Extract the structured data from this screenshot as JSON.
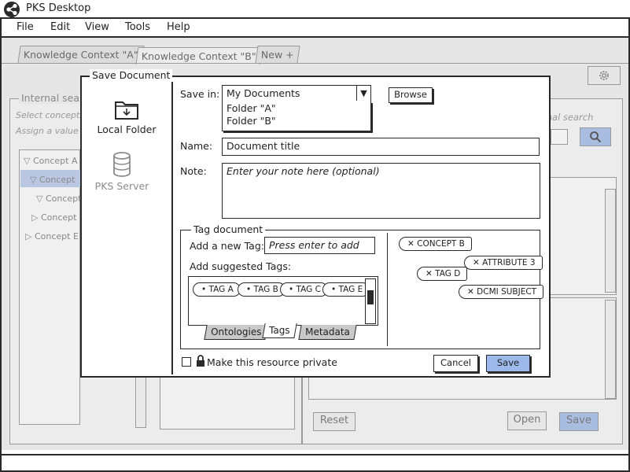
{
  "app": {
    "title": "PKS Desktop"
  },
  "menu": [
    "File",
    "Edit",
    "View",
    "Tools",
    "Help"
  ],
  "tabs": [
    {
      "label": "Knowledge Context \"A\""
    },
    {
      "label": "Knowledge Context \"B\""
    },
    {
      "label": "New +"
    }
  ],
  "background": {
    "left_panel": {
      "title": "Internal sear",
      "hint1": "Select concepts",
      "hint2": "Assign a value t",
      "tree": [
        "Concept A",
        "Concept",
        "Concept",
        "Concept I",
        "Concept E"
      ]
    },
    "right_panel": {
      "search_hint": "rnal search"
    },
    "buttons": {
      "reset": "Reset",
      "open": "Open",
      "save": "Save"
    }
  },
  "dialog": {
    "title": "Save Document",
    "locations": [
      {
        "label": "Local Folder",
        "icon": "folder-icon",
        "enabled": true
      },
      {
        "label": "PKS Server",
        "icon": "database-icon",
        "enabled": false
      }
    ],
    "save_in": {
      "label": "Save in:",
      "value": "My Documents",
      "options": [
        "Folder \"A\"",
        "Folder \"B\""
      ],
      "browse_label": "Browse"
    },
    "name": {
      "label": "Name:",
      "value": "Document title"
    },
    "note": {
      "label": "Note:",
      "placeholder": "Enter your note here (optional)"
    },
    "tag_document": {
      "title": "Tag document",
      "add_new_label": "Add a new Tag:",
      "add_new_placeholder": "Press enter to add",
      "suggested_label": "Add suggested Tags:",
      "suggested_tags": [
        "TAG A",
        "TAG B",
        "TAG C",
        "TAG E"
      ],
      "subtabs": [
        "Ontologies",
        "Tags",
        "Metadata"
      ],
      "active_subtab": "Tags",
      "applied_tags": [
        "CONCEPT B",
        "ATTRIBUTE 3",
        "TAG D",
        "DCMI SUBJECT"
      ]
    },
    "private_label": "Make this resource private",
    "cancel_label": "Cancel",
    "save_label": "Save"
  },
  "colors": {
    "accent": "#9db8ea",
    "dim_bg": "#e6e6e6",
    "ink": "#2a2a2a"
  }
}
